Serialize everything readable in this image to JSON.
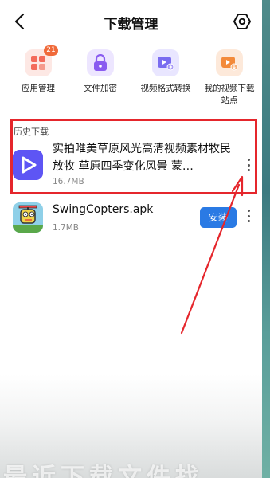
{
  "header": {
    "title": "下载管理",
    "back_icon": "chevron-left-icon",
    "settings_icon": "hexagon-settings-icon"
  },
  "tools": [
    {
      "label": "应用管理",
      "icon": "apps-grid-icon",
      "badge": "21",
      "color": "#f36b5b"
    },
    {
      "label": "文件加密",
      "icon": "lock-icon",
      "color": "#8a5cf0"
    },
    {
      "label": "视频格式转换",
      "icon": "video-convert-icon",
      "color": "#7a6cf0"
    },
    {
      "label": "我的视频下载站点",
      "icon": "video-site-icon",
      "color": "#f38a3a"
    }
  ],
  "history": {
    "section_title": "历史下载",
    "items": [
      {
        "title": "实拍唯美草原风光高清视频素材牧民放牧 草原四季变化风景 蒙…",
        "size": "16.7MB",
        "icon": "play-video-icon",
        "icon_color": "#6b4ef2"
      },
      {
        "title": "SwingCopters.apk",
        "size": "1.7MB",
        "icon": "swing-copters-app-icon",
        "action_label": "安装"
      }
    ]
  },
  "caption": "最近下载文件找",
  "colors": {
    "highlight_box": "#e5262c",
    "annotation_arrow": "#e5262c",
    "install_button": "#2a7ae4"
  }
}
